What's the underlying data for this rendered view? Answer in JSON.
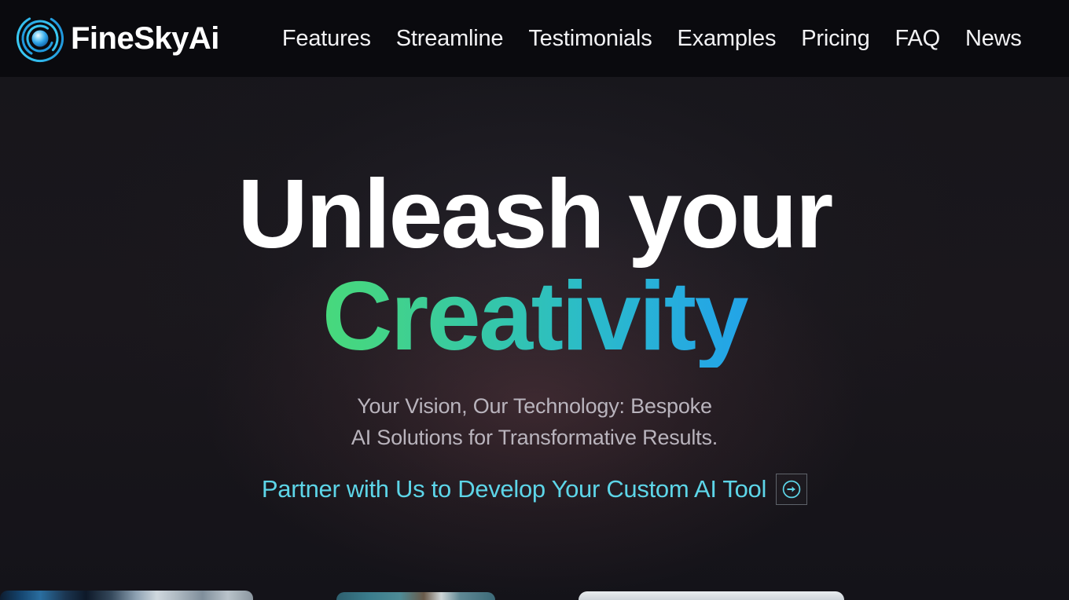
{
  "header": {
    "brand": {
      "name": "FineSkyAi",
      "logo_icon": "concentric-rings-orb-icon",
      "ring_color": "#29c4f0",
      "orb_color": "#39b6f5"
    },
    "nav": [
      {
        "label": "Features"
      },
      {
        "label": "Streamline"
      },
      {
        "label": "Testimonials"
      },
      {
        "label": "Examples"
      },
      {
        "label": "Pricing"
      },
      {
        "label": "FAQ"
      },
      {
        "label": "News"
      }
    ],
    "background": "#0a0a0e"
  },
  "hero": {
    "title_line1": "Unleash your",
    "title_line2": "Creativity",
    "title_gradient_from": "#4ee06a",
    "title_gradient_to": "#1e9bf0",
    "subtitle_line1": "Your Vision, Our Technology: Bespoke",
    "subtitle_line2": "AI Solutions for Transformative Results.",
    "subtitle_color": "#b9b4bd",
    "cta": {
      "label": "Partner with Us to Develop Your Custom AI Tool",
      "color": "#5dd5e8",
      "icon": "arrow-right-circle-icon"
    },
    "background": "#17161b"
  },
  "bottom_strip": {
    "cards": [
      {
        "name": "card-peek-1"
      },
      {
        "name": "card-peek-2"
      },
      {
        "name": "card-peek-3"
      },
      {
        "name": "card-peek-4"
      }
    ]
  }
}
